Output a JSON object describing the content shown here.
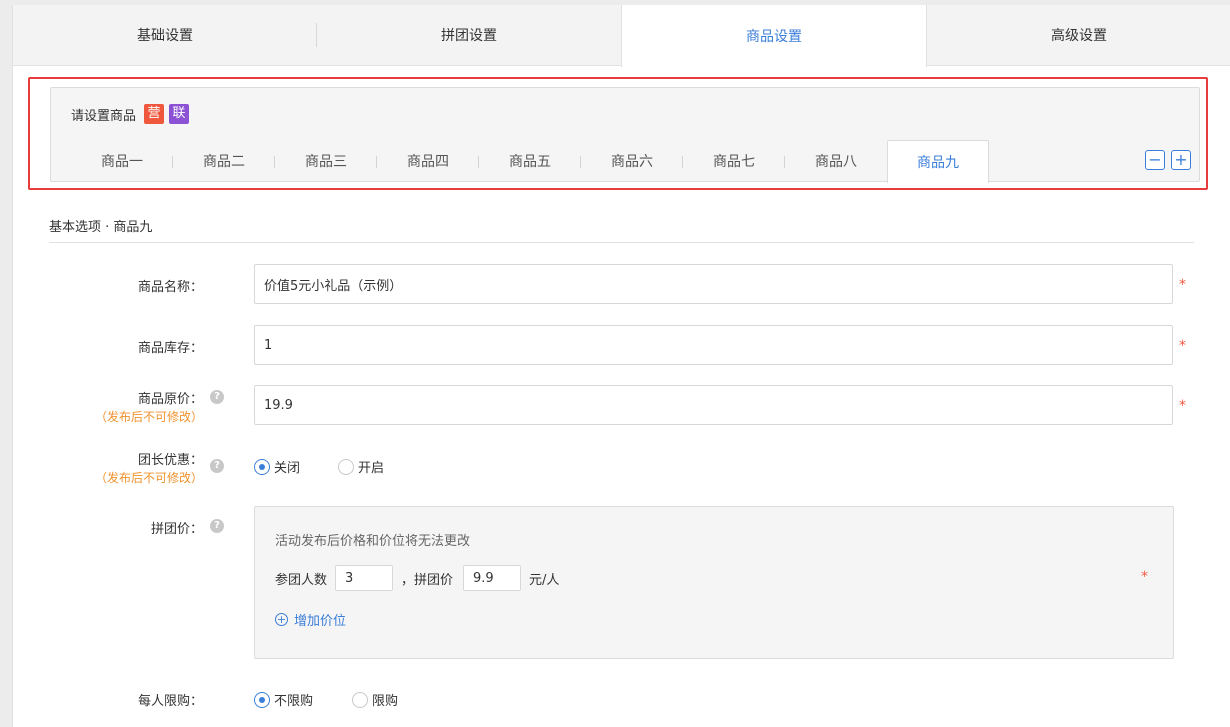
{
  "top_tabs": [
    "基础设置",
    "拼团设置",
    "商品设置",
    "高级设置"
  ],
  "product_panel": {
    "title": "请设置商品",
    "badge_ying": "营",
    "badge_lian": "联",
    "tabs": [
      "商品一",
      "商品二",
      "商品三",
      "商品四",
      "商品五",
      "商品六",
      "商品七",
      "商品八",
      "商品九"
    ],
    "minus_icon": "−",
    "plus_icon": "+"
  },
  "section_title": "基本选项 · 商品九",
  "form": {
    "name_label": "商品名称：",
    "name_value": "价值5元小礼品（示例）",
    "stock_label": "商品库存：",
    "stock_value": "1",
    "price_label": "商品原价：",
    "price_note": "（发布后不可修改）",
    "price_value": "19.9",
    "leader_label": "团长优惠：",
    "leader_note": "（发布后不可修改）",
    "leader_off": "关闭",
    "leader_on": "开启",
    "group_price_label": "拼团价：",
    "group_note": "活动发布后价格和价位将无法更改",
    "members_label": "参团人数",
    "members_value": "3",
    "group_price_text": "，拼团价",
    "group_price_value": "9.9",
    "unit": "元/人",
    "add_price_level": "增加价位",
    "limit_label": "每人限购：",
    "limit_off": "不限购",
    "limit_on": "限购",
    "required_mark": "*",
    "help_mark": "?"
  }
}
